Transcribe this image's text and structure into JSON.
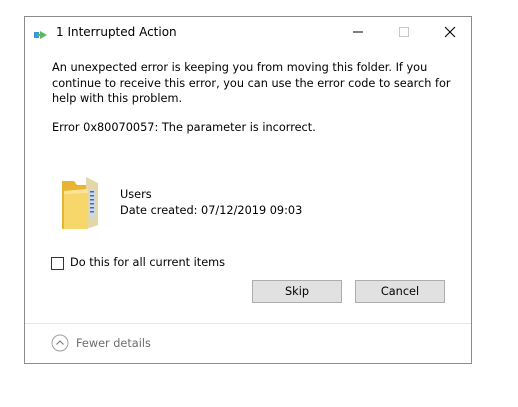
{
  "window": {
    "title": "1 Interrupted Action",
    "icon": "interrupted-action-arrow-icon"
  },
  "message": {
    "text": "An unexpected error is keeping you from moving this folder. If you continue to receive this error, you can use the error code to search for help with this problem.",
    "error": "Error 0x80070057: The parameter is incorrect."
  },
  "item": {
    "icon": "folder-icon",
    "name": "Users",
    "date_created": "Date created: 07/12/2019 09:03"
  },
  "options": {
    "apply_all_label": "Do this for all current items",
    "apply_all_checked": false
  },
  "buttons": {
    "skip_label": "Skip",
    "cancel_label": "Cancel"
  },
  "footer": {
    "fewer_details_label": "Fewer details"
  },
  "colors": {
    "button_bg": "#e1e1e1",
    "button_border": "#adadad",
    "folder": "#f4c542",
    "footer_text": "#6d6d6d"
  }
}
